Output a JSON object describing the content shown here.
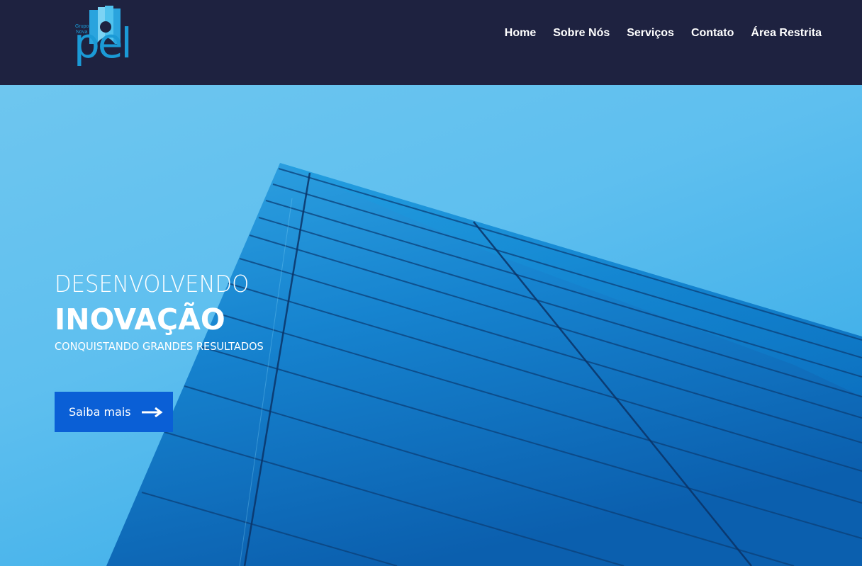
{
  "brand": {
    "logo_small_1": "Grupo",
    "logo_small_2": "Nova",
    "logo_main": "pel",
    "color": "#1b9ad6"
  },
  "nav": {
    "items": [
      {
        "label": "Home"
      },
      {
        "label": "Sobre Nós"
      },
      {
        "label": "Serviços"
      },
      {
        "label": "Contato"
      },
      {
        "label": "Área Restrita"
      }
    ]
  },
  "hero": {
    "kicker": "DESENVOLVENDO",
    "headline": "INOVAÇÃO",
    "subline": "CONQUISTANDO GRANDES RESULTADOS",
    "cta_label": "Saiba mais",
    "cta_icon": "arrow-right-icon",
    "cta_color": "#0a5fd6"
  },
  "colors": {
    "header_bg": "#1e2240",
    "sky": "#5ebfef",
    "building": "#0f72c4"
  }
}
